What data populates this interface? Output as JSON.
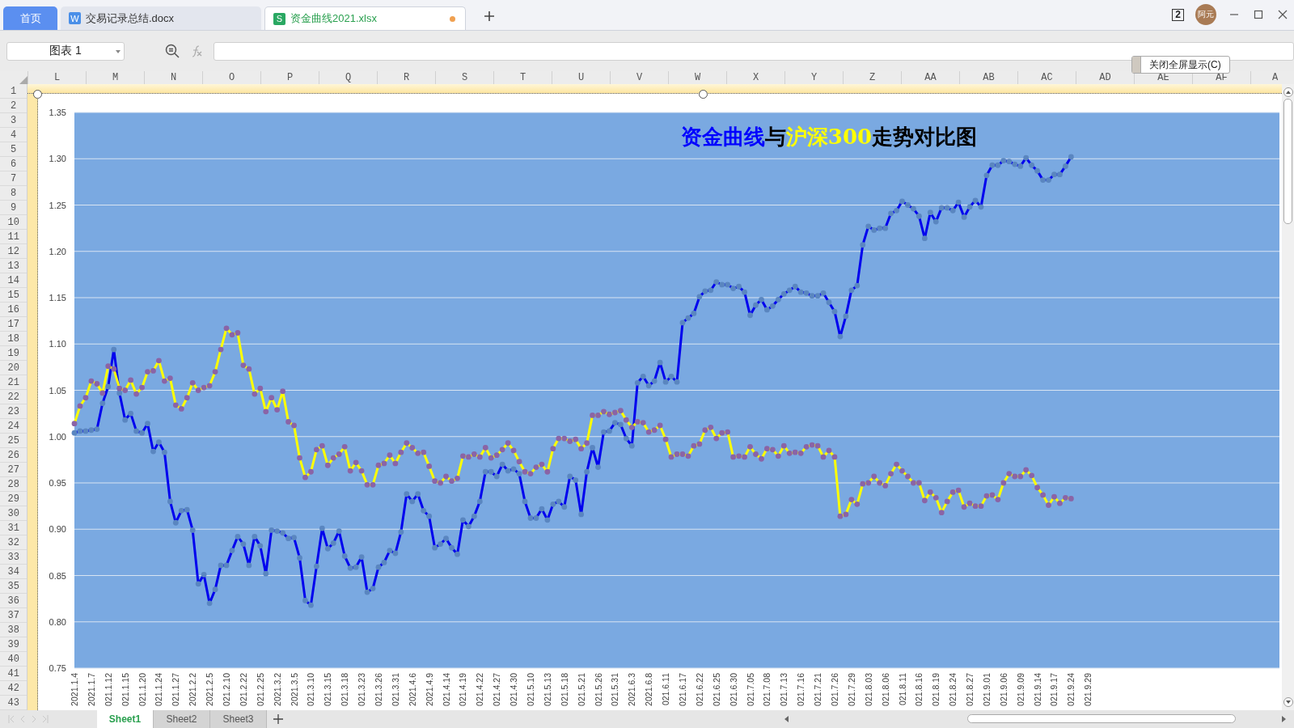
{
  "tabs": [
    {
      "label": "首页",
      "kind": "home",
      "selected": false,
      "modified": false
    },
    {
      "label": "交易记录总结.docx",
      "kind": "writer",
      "icon": "W",
      "selected": false,
      "modified": false
    },
    {
      "label": "资金曲线2021.xlsx",
      "kind": "sheet",
      "icon": "S",
      "selected": true,
      "modified": true
    }
  ],
  "window_count": "2",
  "avatar_text": "阿元",
  "name_box": "图表 1",
  "tooltip": "关闭全屏显示(C)",
  "columns": [
    "L",
    "M",
    "N",
    "O",
    "P",
    "Q",
    "R",
    "S",
    "T",
    "U",
    "V",
    "W",
    "X",
    "Y",
    "Z",
    "AA",
    "AB",
    "AC",
    "AD",
    "AE",
    "AF",
    "A"
  ],
  "rows": [
    "1",
    "2",
    "3",
    "4",
    "5",
    "6",
    "7",
    "8",
    "9",
    "10",
    "11",
    "12",
    "13",
    "14",
    "15",
    "16",
    "17",
    "18",
    "19",
    "20",
    "21",
    "22",
    "23",
    "24",
    "25",
    "26",
    "27",
    "28",
    "29",
    "30",
    "31",
    "32",
    "33",
    "34",
    "35",
    "36",
    "37",
    "38",
    "39",
    "40",
    "41",
    "42",
    "43"
  ],
  "chart": {
    "title_parts": [
      {
        "text": "资金曲线",
        "color": "#0000ff"
      },
      {
        "text": "与",
        "color": "#000000"
      },
      {
        "text": "沪深300",
        "color": "#ffff00"
      },
      {
        "text": "走势对比图",
        "color": "#000000"
      }
    ],
    "chart_data": {
      "type": "line",
      "grid": true,
      "ylim": [
        0.75,
        1.35
      ],
      "yticks": [
        {
          "value": 0.75,
          "label": "0.75"
        },
        {
          "value": 0.8,
          "label": "0.80"
        },
        {
          "value": 0.85,
          "label": "0.85"
        },
        {
          "value": 0.9,
          "label": "0.90"
        },
        {
          "value": 0.95,
          "label": "0.95"
        },
        {
          "value": 1,
          "label": "1.00"
        },
        {
          "value": 1.05,
          "label": "1.05"
        },
        {
          "value": 1.1,
          "label": "1.10"
        },
        {
          "value": 1.15,
          "label": "1.15"
        },
        {
          "value": 1.2,
          "label": "1.20"
        },
        {
          "value": 1.25,
          "label": "1.25"
        },
        {
          "value": 1.3,
          "label": "1.30"
        },
        {
          "value": 1.35,
          "label": "1.35"
        }
      ],
      "categories": [
        "2021.1.4",
        null,
        null,
        "2021.1.7",
        null,
        null,
        "021.1.12",
        null,
        null,
        "021.1.15",
        null,
        null,
        "021.1.20",
        null,
        null,
        "021.1.24",
        null,
        null,
        "021.1.27",
        null,
        null,
        "2021.2.2",
        null,
        null,
        "2021.2.5",
        null,
        null,
        "021.2.10",
        null,
        null,
        "021.2.22",
        null,
        null,
        "021.2.25",
        null,
        null,
        "2021.3.2",
        null,
        null,
        "2021.3.5",
        null,
        null,
        "021.3.10",
        null,
        null,
        "021.3.15",
        null,
        null,
        "021.3.18",
        null,
        null,
        "021.3.23",
        null,
        null,
        "021.3.26",
        null,
        null,
        "021.3.31",
        null,
        null,
        "2021.4.6",
        null,
        null,
        "2021.4.9",
        null,
        null,
        "021.4.14",
        null,
        null,
        "021.4.19",
        null,
        null,
        "021.4.22",
        null,
        null,
        "021.4.27",
        null,
        null,
        "021.4.30",
        null,
        null,
        "021.5.10",
        null,
        null,
        "021.5.13",
        null,
        null,
        "021.5.18",
        null,
        null,
        "021.5.21",
        null,
        null,
        "021.5.26",
        null,
        null,
        "021.5.31",
        null,
        null,
        "2021.6.3",
        null,
        null,
        "2021.6.8",
        null,
        null,
        "021.6.11",
        null,
        null,
        "021.6.17",
        null,
        null,
        "021.6.22",
        null,
        null,
        "021.6.25",
        null,
        null,
        "021.6.30",
        null,
        null,
        "021.7.05",
        null,
        null,
        "021.7.08",
        null,
        null,
        "021.7.13",
        null,
        null,
        "021.7.16",
        null,
        null,
        "021.7.21",
        null,
        null,
        "021.7.26",
        null,
        null,
        "021.7.29",
        null,
        null,
        "021.8.03",
        null,
        null,
        "021.8.06",
        null,
        null,
        "021.8.11",
        null,
        null,
        "021.8.16",
        null,
        null,
        "021.8.19",
        null,
        null,
        "021.8.24",
        null,
        null,
        "021.8.27",
        null,
        null,
        "021.9.01",
        null,
        null,
        "021.9.06",
        null,
        null,
        "021.9.09",
        null,
        null,
        "021.9.14",
        null,
        null,
        "021.9.17",
        null,
        null,
        "021.9.24",
        null,
        null,
        "021.9.29"
      ],
      "series": [
        {
          "color": "#0000ee",
          "marker": "circle",
          "values": [
            1.004,
            1.006,
            1.006,
            1.007,
            1.008,
            1.036,
            1.054,
            1.094,
            1.047,
            1.018,
            1.025,
            1.006,
            1.004,
            1.014,
            0.984,
            0.994,
            0.983,
            0.93,
            0.907,
            0.92,
            0.921,
            0.899,
            0.841,
            0.851,
            0.82,
            0.835,
            0.861,
            0.861,
            0.877,
            0.892,
            0.884,
            0.861,
            0.892,
            0.882,
            0.852,
            0.899,
            0.898,
            0.896,
            0.89,
            0.891,
            0.869,
            0.823,
            0.818,
            0.86,
            0.901,
            0.879,
            0.885,
            0.898,
            0.871,
            0.858,
            0.859,
            0.87,
            0.832,
            0.836,
            0.859,
            0.864,
            0.877,
            0.874,
            0.897,
            0.938,
            0.93,
            0.938,
            0.92,
            0.914,
            0.88,
            0.884,
            0.89,
            0.88,
            0.873,
            0.91,
            0.903,
            0.914,
            0.93,
            0.962,
            0.962,
            0.957,
            0.97,
            0.963,
            0.965,
            0.96,
            0.93,
            0.912,
            0.912,
            0.922,
            0.91,
            0.927,
            0.93,
            0.924,
            0.957,
            0.953,
            0.916,
            0.962,
            0.988,
            0.967,
            1.005,
            1.006,
            1.015,
            1.013,
            0.998,
            0.99,
            1.058,
            1.065,
            1.055,
            1.06,
            1.08,
            1.059,
            1.065,
            1.059,
            1.123,
            1.128,
            1.133,
            1.151,
            1.157,
            1.158,
            1.167,
            1.164,
            1.164,
            1.16,
            1.162,
            1.156,
            1.131,
            1.142,
            1.148,
            1.137,
            1.141,
            1.148,
            1.154,
            1.158,
            1.162,
            1.156,
            1.155,
            1.152,
            1.152,
            1.155,
            1.145,
            1.135,
            1.108,
            1.13,
            1.158,
            1.163,
            1.207,
            1.227,
            1.223,
            1.225,
            1.225,
            1.241,
            1.244,
            1.254,
            1.25,
            1.246,
            1.238,
            1.214,
            1.242,
            1.232,
            1.247,
            1.247,
            1.244,
            1.253,
            1.237,
            1.248,
            1.255,
            1.248,
            1.282,
            1.293,
            1.293,
            1.298,
            1.297,
            1.294,
            1.292,
            1.301,
            1.293,
            1.287,
            1.277,
            1.277,
            1.283,
            1.283,
            1.292,
            1.302,
            null,
            null,
            null
          ]
        },
        {
          "color": "#ffff00",
          "marker": "circle",
          "values": [
            1.014,
            1.033,
            1.042,
            1.06,
            1.057,
            1.047,
            1.076,
            1.073,
            1.052,
            1.05,
            1.061,
            1.046,
            1.053,
            1.07,
            1.071,
            1.082,
            1.06,
            1.063,
            1.034,
            1.03,
            1.042,
            1.058,
            1.05,
            1.053,
            1.055,
            1.07,
            1.094,
            1.117,
            1.11,
            1.112,
            1.077,
            1.073,
            1.046,
            1.052,
            1.027,
            1.042,
            1.029,
            1.049,
            1.016,
            1.012,
            0.977,
            0.956,
            0.962,
            0.986,
            0.99,
            0.969,
            0.977,
            0.981,
            0.989,
            0.963,
            0.972,
            0.963,
            0.948,
            0.948,
            0.969,
            0.971,
            0.98,
            0.971,
            0.983,
            0.993,
            0.988,
            0.982,
            0.983,
            0.968,
            0.952,
            0.95,
            0.957,
            0.952,
            0.955,
            0.979,
            0.978,
            0.981,
            0.978,
            0.988,
            0.977,
            0.98,
            0.986,
            0.993,
            0.985,
            0.973,
            0.962,
            0.96,
            0.967,
            0.97,
            0.962,
            0.987,
            0.998,
            0.998,
            0.995,
            0.997,
            0.987,
            0.993,
            1.023,
            1.023,
            1.027,
            1.024,
            1.026,
            1.028,
            1.018,
            1.01,
            1.016,
            1.015,
            1.005,
            1.007,
            1.012,
            0.997,
            0.978,
            0.981,
            0.981,
            0.979,
            0.99,
            0.992,
            1.007,
            1.01,
            0.998,
            1.004,
            1.005,
            0.978,
            0.979,
            0.978,
            0.989,
            0.981,
            0.976,
            0.987,
            0.986,
            0.979,
            0.99,
            0.982,
            0.983,
            0.982,
            0.989,
            0.991,
            0.99,
            0.978,
            0.985,
            0.978,
            0.914,
            0.916,
            0.932,
            0.927,
            0.949,
            0.95,
            0.957,
            0.95,
            0.947,
            0.96,
            0.97,
            0.963,
            0.957,
            0.95,
            0.95,
            0.931,
            0.94,
            0.934,
            0.918,
            0.93,
            0.94,
            0.942,
            0.924,
            0.928,
            0.925,
            0.925,
            0.936,
            0.937,
            0.932,
            0.95,
            0.96,
            0.957,
            0.957,
            0.964,
            0.958,
            0.945,
            0.937,
            0.926,
            0.935,
            0.928,
            0.934,
            0.933,
            null,
            null,
            null
          ]
        }
      ]
    }
  },
  "sheets": [
    {
      "label": "Sheet1",
      "selected": true
    },
    {
      "label": "Sheet2",
      "selected": false
    },
    {
      "label": "Sheet3",
      "selected": false
    }
  ]
}
